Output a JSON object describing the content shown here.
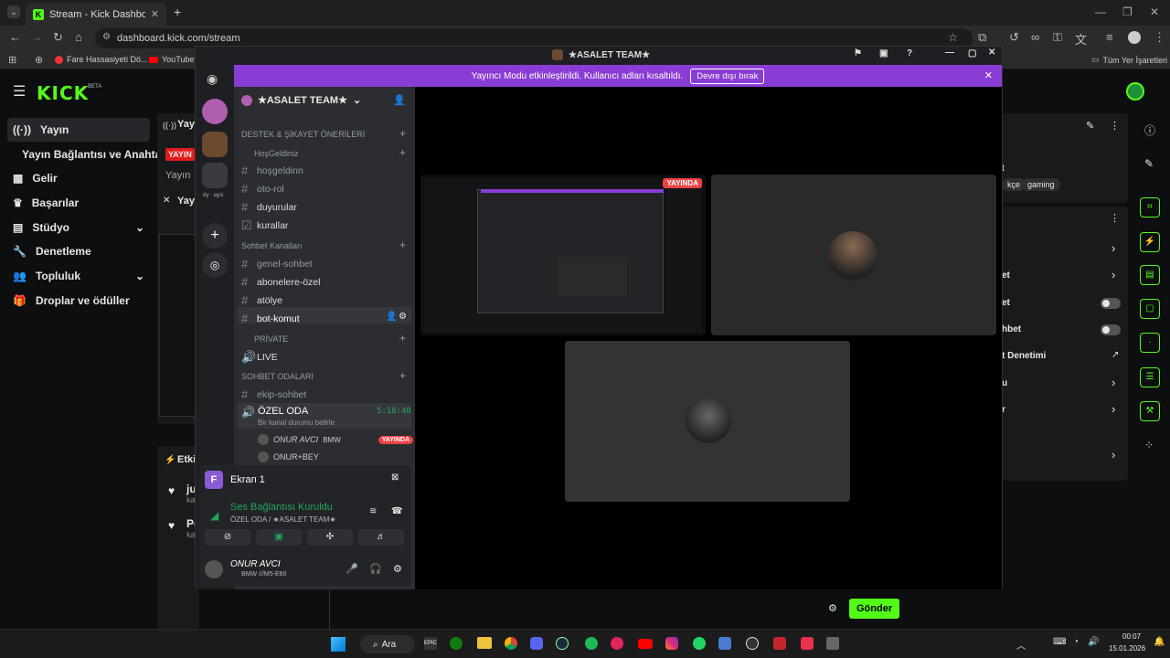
{
  "browser": {
    "tab_title": "Stream - Kick Dashboard",
    "url": "dashboard.kick.com/stream",
    "bookmarks": [
      "Fare Hassasiyeti Dö...",
      "YouTube"
    ],
    "all_bookmarks": "Tüm Yer İşaretleri"
  },
  "kick": {
    "logo": "KICK",
    "beta": "BETA",
    "sidebar": [
      {
        "label": "Yayın"
      },
      {
        "label": "Yayın Bağlantısı ve Anahtarı"
      },
      {
        "label": "Gelir"
      },
      {
        "label": "Başarılar"
      },
      {
        "label": "Stüdyo"
      },
      {
        "label": "Denetleme"
      },
      {
        "label": "Topluluk"
      },
      {
        "label": "Droplar ve ödüller"
      }
    ],
    "left_panel": {
      "tag1": "Yayı",
      "live": "YAYIN",
      "sub": "Yayın",
      "tag2": "Yayı",
      "events": "Etkin",
      "ev1": "ju",
      "ev1b": "ka",
      "ev2": "Po",
      "ev2b": "ka"
    },
    "right_panel": {
      "tags": [
        "kçe",
        "gaming"
      ],
      "t": "t",
      "rows": [
        "et",
        "et",
        "hbet",
        "t Denetimi",
        "u",
        "r"
      ]
    },
    "send_label": "Gönder"
  },
  "discord": {
    "window_title": "★ASALET TEAM★",
    "banner_text": "Yayıncı Modu etkinleştirildi. Kullanıcı adları kısaltıldı.",
    "banner_button": "Devre dışı bırak",
    "server_name": "★ASALET TEAM★",
    "channels": [
      {
        "kind": "cat",
        "label": "DESTEK & ŞİKAYET ÖNERİLERİ"
      },
      {
        "kind": "cat",
        "label": "HoşGeldiniz"
      },
      {
        "kind": "ch",
        "label": "hoşgeldinn"
      },
      {
        "kind": "ch",
        "label": "oto-rol"
      },
      {
        "kind": "ch",
        "label": "duyurular"
      },
      {
        "kind": "ch",
        "label": "kurallar"
      },
      {
        "kind": "cat",
        "label": "Sohbet Kanalları"
      },
      {
        "kind": "ch",
        "label": "genel-sohbet"
      },
      {
        "kind": "ch",
        "label": "abonelere-özel"
      },
      {
        "kind": "ch",
        "label": "atölye"
      },
      {
        "kind": "ch",
        "label": "bot-komut"
      },
      {
        "kind": "cat",
        "label": "PRİVATE"
      },
      {
        "kind": "ch",
        "label": "LIVE"
      },
      {
        "kind": "cat",
        "label": "SOHBET ODALARI"
      },
      {
        "kind": "ch",
        "label": "ekip-sohbet"
      }
    ],
    "voice": {
      "room": "ÖZEL ODA",
      "time": "5:18:40",
      "status": "Bir kanal durumu belirle",
      "user1": "ONUR AVCI",
      "user1_tag": "BMW",
      "user1_live": "YAYINDA",
      "user2": "ONUR+BEY"
    },
    "popup": {
      "title": "Ekran 1",
      "connected": "Ses Bağlantısı Kuruldu",
      "path": "ÖZEL ODA / ★ASALET TEAM★"
    },
    "user_panel": {
      "name": "ONUR AVCI",
      "status": "BMW ///M5-E60"
    },
    "stage_live": "YAYINDA"
  },
  "taskbar": {
    "search": "Ara",
    "time": "00:07",
    "date": "15.01.2026"
  },
  "colors": {
    "kick_green": "#53fc18",
    "discord_banner": "#8a3dd4",
    "live_red": "#ed4245"
  }
}
